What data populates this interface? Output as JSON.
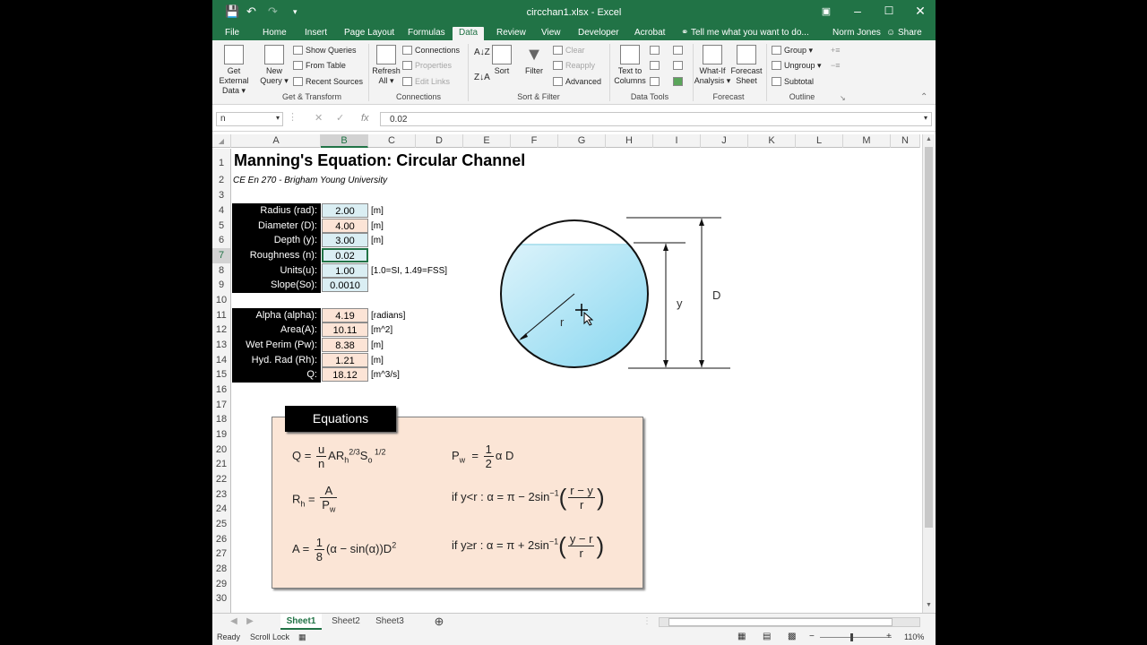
{
  "app": {
    "title": "circchan1.xlsx - Excel",
    "user": "Norm Jones",
    "share": "Share",
    "tell_me": "Tell me what you want to do..."
  },
  "ribbon_tabs": [
    "File",
    "Home",
    "Insert",
    "Page Layout",
    "Formulas",
    "Data",
    "Review",
    "View",
    "Developer",
    "Acrobat"
  ],
  "active_tab": "Data",
  "ribbon": {
    "get_external": [
      "Get External",
      "Data"
    ],
    "new_query": [
      "New",
      "Query"
    ],
    "show_queries": "Show Queries",
    "from_table": "From Table",
    "recent_sources": "Recent Sources",
    "refresh_all": [
      "Refresh",
      "All"
    ],
    "connections": "Connections",
    "properties": "Properties",
    "edit_links": "Edit Links",
    "sort": "Sort",
    "filter": "Filter",
    "clear": "Clear",
    "reapply": "Reapply",
    "advanced": "Advanced",
    "text_to_columns": [
      "Text to",
      "Columns"
    ],
    "what_if": [
      "What-If",
      "Analysis"
    ],
    "forecast_sheet": [
      "Forecast",
      "Sheet"
    ],
    "group": "Group",
    "ungroup": "Ungroup",
    "subtotal": "Subtotal",
    "groups": {
      "get_transform": "Get & Transform",
      "connections": "Connections",
      "sort_filter": "Sort & Filter",
      "data_tools": "Data Tools",
      "forecast": "Forecast",
      "outline": "Outline"
    }
  },
  "formula_bar": {
    "name_box": "n",
    "fx": "fx",
    "value": "0.02"
  },
  "columns": [
    "A",
    "B",
    "C",
    "D",
    "E",
    "F",
    "G",
    "H",
    "I",
    "J",
    "K",
    "L",
    "M",
    "N"
  ],
  "rows": [
    "1",
    "2",
    "3",
    "4",
    "5",
    "6",
    "7",
    "8",
    "9",
    "10",
    "11",
    "12",
    "13",
    "14",
    "15",
    "16",
    "17",
    "18",
    "19",
    "20",
    "21",
    "22",
    "23",
    "24",
    "25",
    "26",
    "27",
    "28",
    "29",
    "30"
  ],
  "sheet": {
    "title": "Manning's Equation: Circular Channel",
    "subtitle": "CE En 270 - Brigham Young University",
    "inputs": [
      {
        "label": "Radius (rad):",
        "value": "2.00",
        "unit": "[m]",
        "kind": "in"
      },
      {
        "label": "Diameter (D):",
        "value": "4.00",
        "unit": "[m]",
        "kind": "out"
      },
      {
        "label": "Depth (y):",
        "value": "3.00",
        "unit": "[m]",
        "kind": "in"
      },
      {
        "label": "Roughness (n):",
        "value": "0.02",
        "unit": "",
        "kind": "in"
      },
      {
        "label": "Units(u):",
        "value": "1.00",
        "unit": "[1.0=SI, 1.49=FSS]",
        "kind": "in"
      },
      {
        "label": "Slope(So):",
        "value": "0.0010",
        "unit": "",
        "kind": "in"
      }
    ],
    "outputs": [
      {
        "label": "Alpha (alpha):",
        "value": "4.19",
        "unit": "[radians]"
      },
      {
        "label": "Area(A):",
        "value": "10.11",
        "unit": "[m^2]"
      },
      {
        "label": "Wet Perim (Pw):",
        "value": "8.38",
        "unit": "[m]"
      },
      {
        "label": "Hyd. Rad (Rh):",
        "value": "1.21",
        "unit": "[m]"
      },
      {
        "label": "Q:",
        "value": "18.12",
        "unit": "[m^3/s]"
      }
    ],
    "diagram": {
      "label_r": "r",
      "label_y": "y",
      "label_D": "D"
    },
    "equations_title": "Equations"
  },
  "sheet_tabs": [
    "Sheet1",
    "Sheet2",
    "Sheet3"
  ],
  "status": {
    "ready": "Ready",
    "scroll_lock": "Scroll Lock",
    "zoom": "110%"
  }
}
